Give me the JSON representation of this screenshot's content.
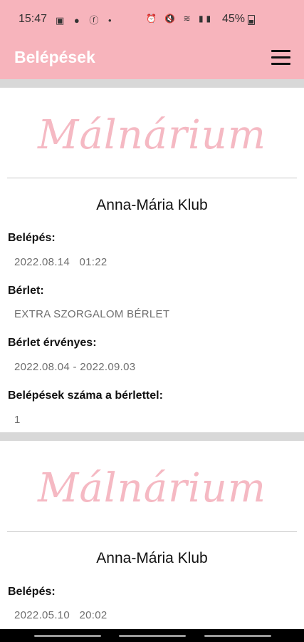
{
  "status_bar": {
    "time": "15:47",
    "left_icons": "▣ ● ⓕ •",
    "right_icons": "⏰ 🔇 ≋ ▮▮",
    "battery": "45%"
  },
  "app_bar": {
    "title": "Belépések",
    "menu_icon": "hamburger-menu-icon"
  },
  "colors": {
    "accent": "#f7b4bc",
    "logo": "#f5b9c3"
  },
  "entries": [
    {
      "logo_text": "Málnárium",
      "club": "Anna-Mária Klub",
      "entry_label": "Belépés:",
      "entry_value": "2022.08.14   01:22",
      "pass_label": "Bérlet:",
      "pass_value": "EXTRA SZORGALOM BÉRLET",
      "validity_label": "Bérlet érvényes:",
      "validity_value": "2022.08.04 - 2022.09.03",
      "count_label": "Belépések száma a bérlettel:",
      "count_value": "1"
    },
    {
      "logo_text": "Málnárium",
      "club": "Anna-Mária Klub",
      "entry_label": "Belépés:",
      "entry_value": "2022.05.10   20:02"
    }
  ]
}
